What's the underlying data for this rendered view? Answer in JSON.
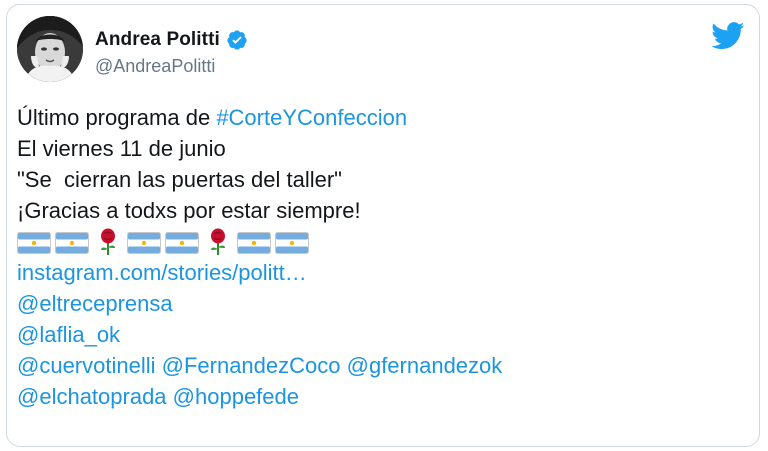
{
  "author": {
    "display_name": "Andrea Politti",
    "handle": "@AndreaPolitti",
    "verified": true
  },
  "icons": {
    "logo": "twitter-bird-icon",
    "verified": "verified-badge-icon",
    "emoji": [
      "argentina-flag-icon",
      "argentina-flag-icon",
      "rose-icon",
      "argentina-flag-icon",
      "argentina-flag-icon",
      "rose-icon",
      "argentina-flag-icon",
      "argentina-flag-icon"
    ]
  },
  "colors": {
    "link": "#1b95e0",
    "text": "#14171a",
    "secondary": "#657786",
    "brand": "#1da1f2"
  },
  "tweet": {
    "line1_text": "Último programa de ",
    "line1_hashtag": "#CorteYConfeccion",
    "line2": "El viernes 11 de junio",
    "line3": "\"Se  cierran las puertas del taller\"",
    "line4": "¡Gracias a todxs por estar siempre!",
    "link": "instagram.com/stories/politt…",
    "mention_1": "@eltreceprensa",
    "mention_2": "@laflia_ok",
    "mention_3a": "@cuervotinelli",
    "mention_3b": "@FernandezCoco",
    "mention_3c": "@gfernandezok",
    "mention_4a": "@elchatoprada",
    "mention_4b": "@hoppefede"
  }
}
